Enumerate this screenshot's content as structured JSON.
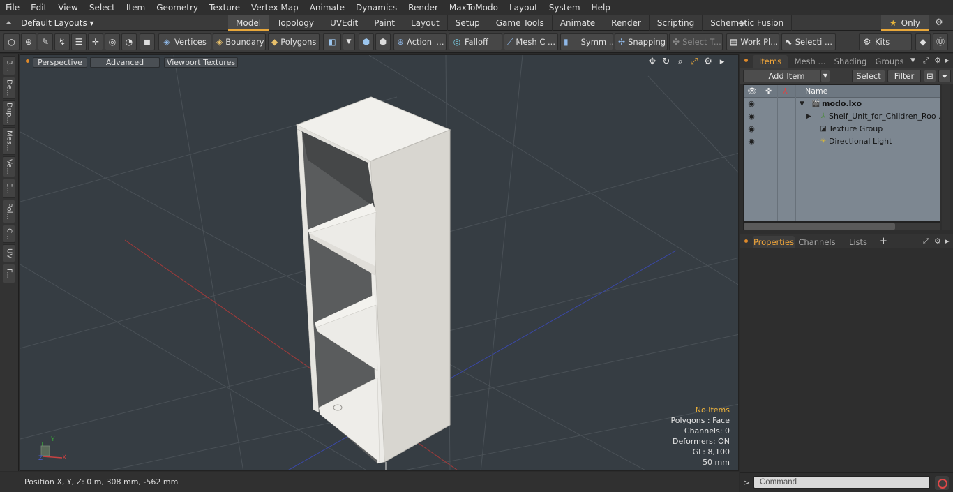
{
  "menu": [
    "File",
    "Edit",
    "View",
    "Select",
    "Item",
    "Geometry",
    "Texture",
    "Vertex Map",
    "Animate",
    "Dynamics",
    "Render",
    "MaxToModo",
    "Layout",
    "System",
    "Help"
  ],
  "layouts": {
    "selector": "Default Layouts ▾",
    "tabs": [
      "Model",
      "Topology",
      "UVEdit",
      "Paint",
      "Layout",
      "Setup",
      "Game Tools",
      "Animate",
      "Render",
      "Scripting",
      "Schematic Fusion"
    ],
    "active_tab": "Model",
    "only_label": "Only"
  },
  "toolbar": {
    "vertices": "Vertices",
    "boundary": "Boundary",
    "polygons": "Polygons",
    "action": "Action",
    "falloff": "Falloff",
    "mesh": "Mesh C ...",
    "symm": "Symm ...",
    "snapping": "Snapping",
    "select_t": "Select T...",
    "work_pl": "Work Pl...",
    "selecti": "Selecti ...",
    "kits": "Kits"
  },
  "left_tools": [
    "B...",
    "De...",
    "Dup...",
    "Mes...",
    "Ve...",
    "E...",
    "Pol...",
    "C...",
    "UV",
    "F..."
  ],
  "viewport": {
    "view_mode": "Perspective",
    "advanced": "Advanced",
    "textures": "Viewport Textures",
    "stats": {
      "items": "No Items",
      "polygons": "Polygons : Face",
      "channels": "Channels: 0",
      "deformers": "Deformers: ON",
      "gl": "GL: 8,100",
      "grid": "50 mm"
    },
    "axis": {
      "x": "X",
      "y": "Y",
      "z": "Z"
    }
  },
  "status": {
    "position": "Position X, Y, Z:   0 m, 308 mm, -562 mm"
  },
  "items_panel": {
    "tabs": [
      "Items",
      "Mesh ...",
      "Shading",
      "Groups"
    ],
    "active_tab": "Items",
    "add_item": "Add Item",
    "select": "Select",
    "filter": "Filter",
    "column_name": "Name",
    "rows": [
      {
        "label": "modo.lxo",
        "icon": "scene-icon"
      },
      {
        "label": "Shelf_Unit_for_Children_Roo ...",
        "icon": "mesh-locator-icon"
      },
      {
        "label": "Texture Group",
        "icon": "texture-group-icon"
      },
      {
        "label": "Directional Light",
        "icon": "light-icon"
      }
    ]
  },
  "properties_panel": {
    "tabs": [
      "Properties",
      "Channels",
      "Lists"
    ],
    "active_tab": "Properties"
  },
  "command": {
    "placeholder": "Command"
  },
  "colors": {
    "accent": "#e8a73a",
    "viewport_bg": "#363d43",
    "shelf": "#ecebe7",
    "list_bg": "#7d8791"
  }
}
